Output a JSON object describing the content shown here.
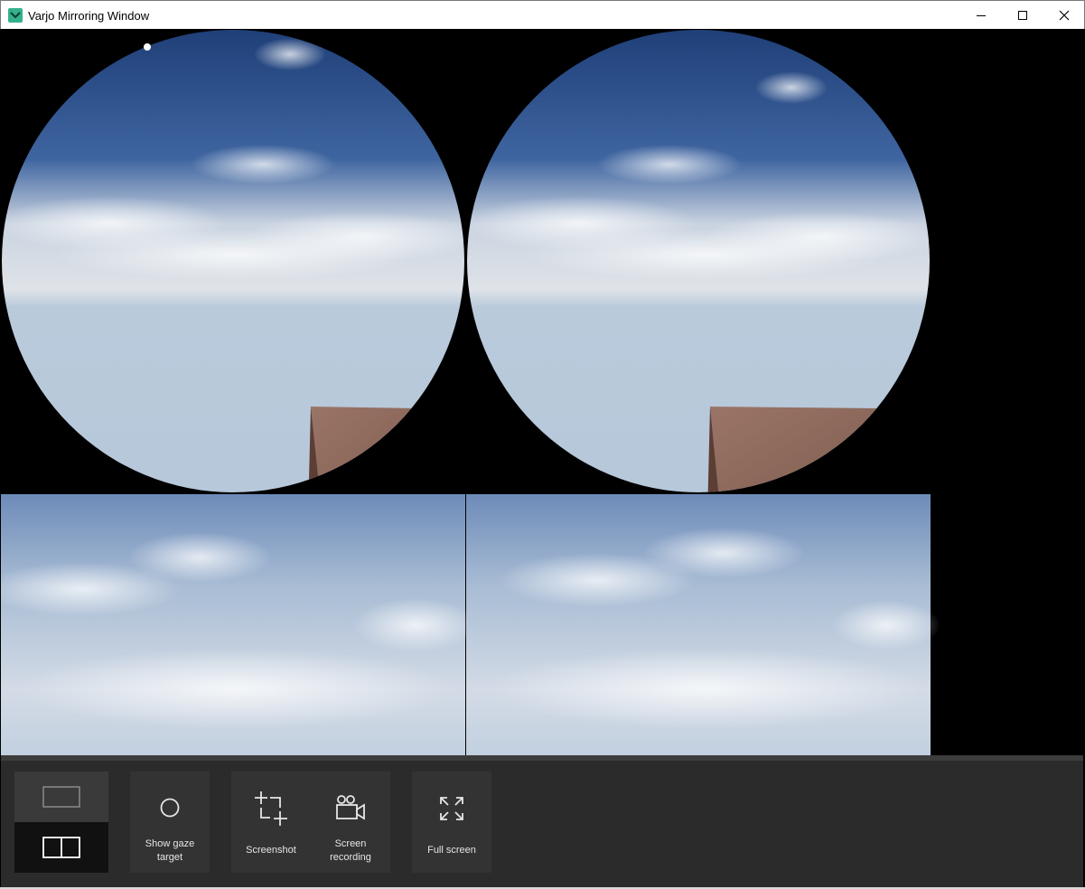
{
  "window": {
    "title": "Varjo Mirroring Window",
    "icons": {
      "app": "varjo-app-icon",
      "minimize": "minimize-icon",
      "maximize": "maximize-icon",
      "close": "close-icon"
    }
  },
  "views": {
    "context_left": "left-eye-context-view",
    "context_right": "right-eye-context-view",
    "focus_left": "left-eye-focus-view",
    "focus_right": "right-eye-focus-view"
  },
  "toolbar": {
    "view_mode": {
      "options": [
        "single-view-icon",
        "dual-view-icon"
      ],
      "selected": "dual-view-icon"
    },
    "show_gaze_target": {
      "line1": "Show gaze",
      "line2": "target",
      "icon": "gaze-circle-icon"
    },
    "screenshot": {
      "label": "Screenshot",
      "icon": "screenshot-icon"
    },
    "screen_recording": {
      "line1": "Screen",
      "line2": "recording",
      "icon": "video-camera-icon"
    },
    "full_screen": {
      "label": "Full screen",
      "icon": "fullscreen-icon"
    }
  },
  "colors": {
    "toolbar_bg": "#2b2b2b",
    "button_bg": "#333333",
    "selected_mode_bg": "#111111",
    "app_icon": "#34b08d",
    "sky_top": "#1f3f78",
    "sky_bottom": "#b9cadb",
    "box": "#8b6357"
  }
}
